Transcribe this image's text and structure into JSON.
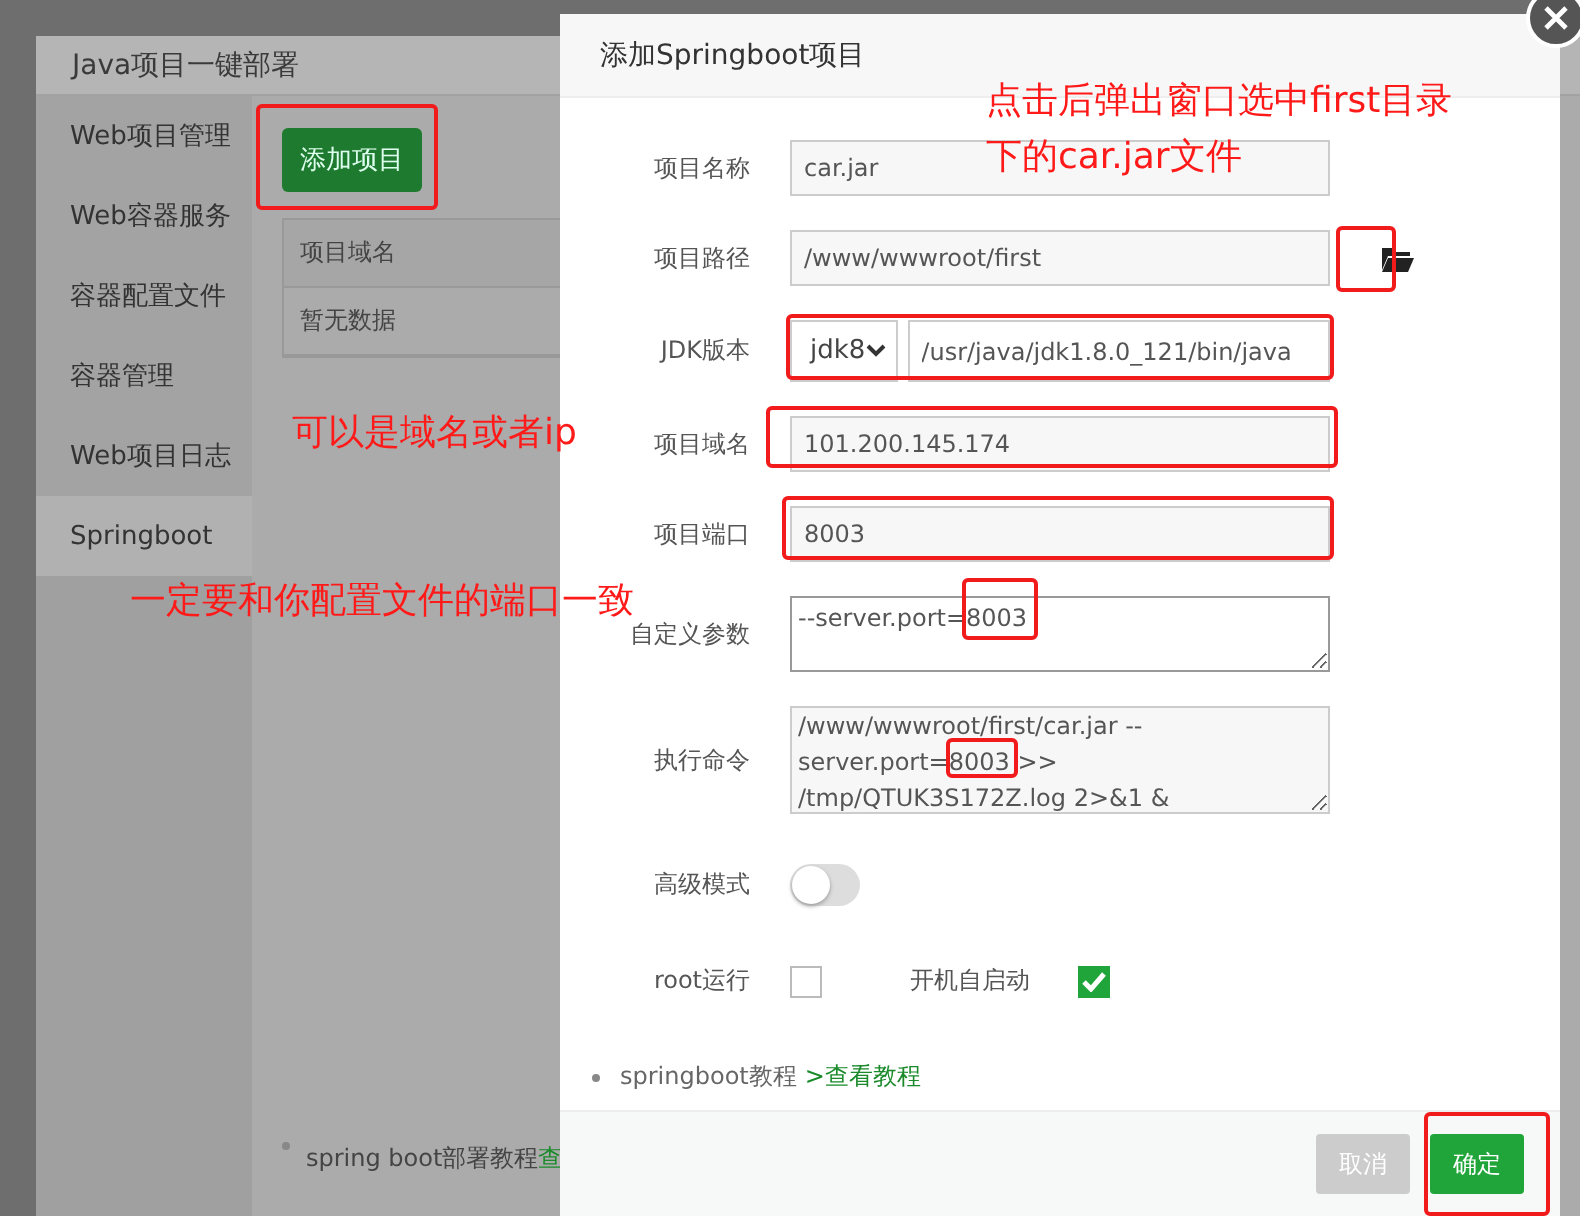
{
  "back_dialog": {
    "title": "Java项目一键部署",
    "sidebar": [
      {
        "label": "Web项目管理",
        "selected": false
      },
      {
        "label": "Web容器服务",
        "selected": false
      },
      {
        "label": "容器配置文件",
        "selected": false
      },
      {
        "label": "容器管理",
        "selected": false
      },
      {
        "label": "Web项目日志",
        "selected": false
      },
      {
        "label": "Springboot",
        "selected": true
      }
    ],
    "add_button": "添加项目",
    "table": {
      "columns": [
        "项目域名"
      ],
      "empty_text": "暂无数据"
    },
    "help": {
      "text": "spring boot部署教程",
      "link": "查"
    }
  },
  "dialog": {
    "title": "添加Springboot项目",
    "fields": [
      {
        "kind": "text",
        "label": "项目名称",
        "value": "car.jar"
      },
      {
        "kind": "path",
        "label": "项目路径",
        "value": "/www/wwwroot/first"
      },
      {
        "kind": "jdk",
        "label": "JDK版本",
        "select": "jdk8",
        "value": "/usr/java/jdk1.8.0_121/bin/java"
      },
      {
        "kind": "text",
        "label": "项目域名",
        "value": "101.200.145.174"
      },
      {
        "kind": "text",
        "label": "项目端口",
        "value": "8003"
      },
      {
        "kind": "textarea",
        "label": "自定义参数",
        "value": "--server.port=8003"
      },
      {
        "kind": "command",
        "label": "执行命令",
        "value": "/www/wwwroot/first/car.jar --server.port=8003 >> /tmp/QTUK3S172Z.log 2>&1 &"
      },
      {
        "kind": "toggle",
        "label": "高级模式",
        "on": false
      },
      {
        "kind": "checks",
        "items": [
          {
            "label": "root运行",
            "checked": false
          },
          {
            "label": "开机自启动",
            "checked": true
          }
        ]
      }
    ],
    "help": {
      "text": "springboot教程",
      "link": ">查看教程"
    },
    "buttons": [
      {
        "kind": "cancel",
        "label": "取消"
      },
      {
        "kind": "confirm",
        "label": "确定"
      }
    ]
  },
  "annotations": [
    "点击后弹出窗口选中first目录",
    "下的car.jar文件",
    "可以是域名或者ip",
    "一定要和你配置文件的端口一致"
  ]
}
